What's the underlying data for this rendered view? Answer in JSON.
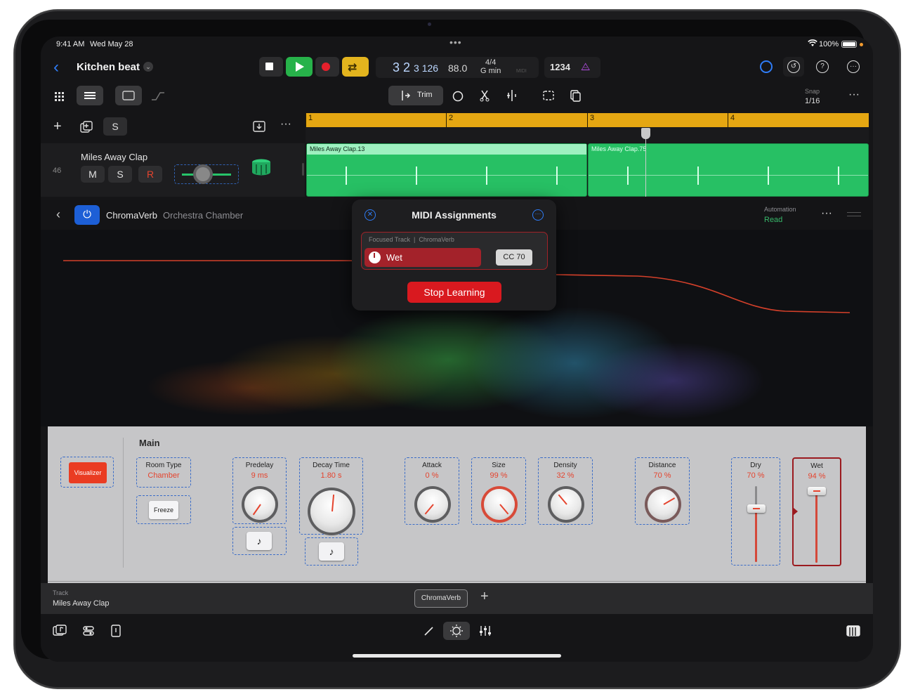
{
  "status_bar": {
    "time": "9:41 AM",
    "date": "Wed May 28",
    "battery": "100%"
  },
  "header": {
    "project_title": "Kitchen beat",
    "position_main": "3 2",
    "position_sub": "3 126",
    "tempo": "88.0",
    "time_signature": "4/4",
    "key": "G min",
    "midi_label": "MIDI",
    "count_in": "1234"
  },
  "toolbar2": {
    "trim_label": "Trim",
    "snap_label": "Snap",
    "snap_value": "1/16"
  },
  "track_header": {
    "solo_label": "S"
  },
  "track": {
    "number": "46",
    "name": "Miles Away Clap",
    "mute": "M",
    "solo": "S",
    "record": "R"
  },
  "timeline": {
    "bars": [
      "1",
      "2",
      "3",
      "4"
    ],
    "regions": [
      {
        "name": "Miles Away Clap.13"
      },
      {
        "name": "Miles Away Clap.75"
      }
    ]
  },
  "plugin": {
    "name": "ChromaVerb",
    "preset": "Orchestra Chamber",
    "automation_label": "Automation",
    "automation_value": "Read"
  },
  "midi_popup": {
    "title": "MIDI Assignments",
    "focused_track_label": "Focused Track",
    "plugin_label": "ChromaVerb",
    "parameter": "Wet",
    "cc": "CC 70",
    "stop_label": "Stop Learning"
  },
  "controls": {
    "section": "Main",
    "visualizer_label": "Visualizer",
    "room_type_label": "Room Type",
    "room_type_value": "Chamber",
    "freeze_label": "Freeze",
    "predelay_label": "Predelay",
    "predelay_value": "9 ms",
    "decay_label": "Decay Time",
    "decay_value": "1.80 s",
    "attack_label": "Attack",
    "attack_value": "0 %",
    "size_label": "Size",
    "size_value": "99 %",
    "density_label": "Density",
    "density_value": "32 %",
    "distance_label": "Distance",
    "distance_value": "70 %",
    "dry_label": "Dry",
    "dry_value": "70 %",
    "dry_level": 0.7,
    "wet_label": "Wet",
    "wet_value": "94 %",
    "wet_level": 0.94
  },
  "track_strip": {
    "label": "Track",
    "value": "Miles Away Clap",
    "plugin_button": "ChromaVerb"
  },
  "colors": {
    "accent_blue": "#2f7cf6",
    "record_red": "#e5202c",
    "region_green": "#27c064",
    "ruler_gold": "#e5a712",
    "param_orange": "#e5442e"
  }
}
